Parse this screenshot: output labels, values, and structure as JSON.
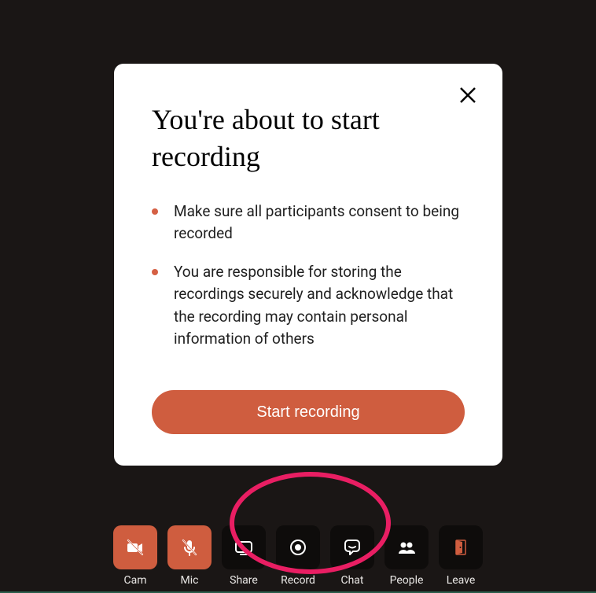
{
  "modal": {
    "title": "You're about to start recording",
    "bullets": [
      "Make sure all participants consent to being recorded",
      "You are responsible for storing the recordings securely and acknowledge that the recording may contain personal information of others"
    ],
    "button_label": "Start recording"
  },
  "toolbar": {
    "cam": "Cam",
    "mic": "Mic",
    "share": "Share",
    "record": "Record",
    "chat": "Chat",
    "people": "People",
    "leave": "Leave"
  }
}
